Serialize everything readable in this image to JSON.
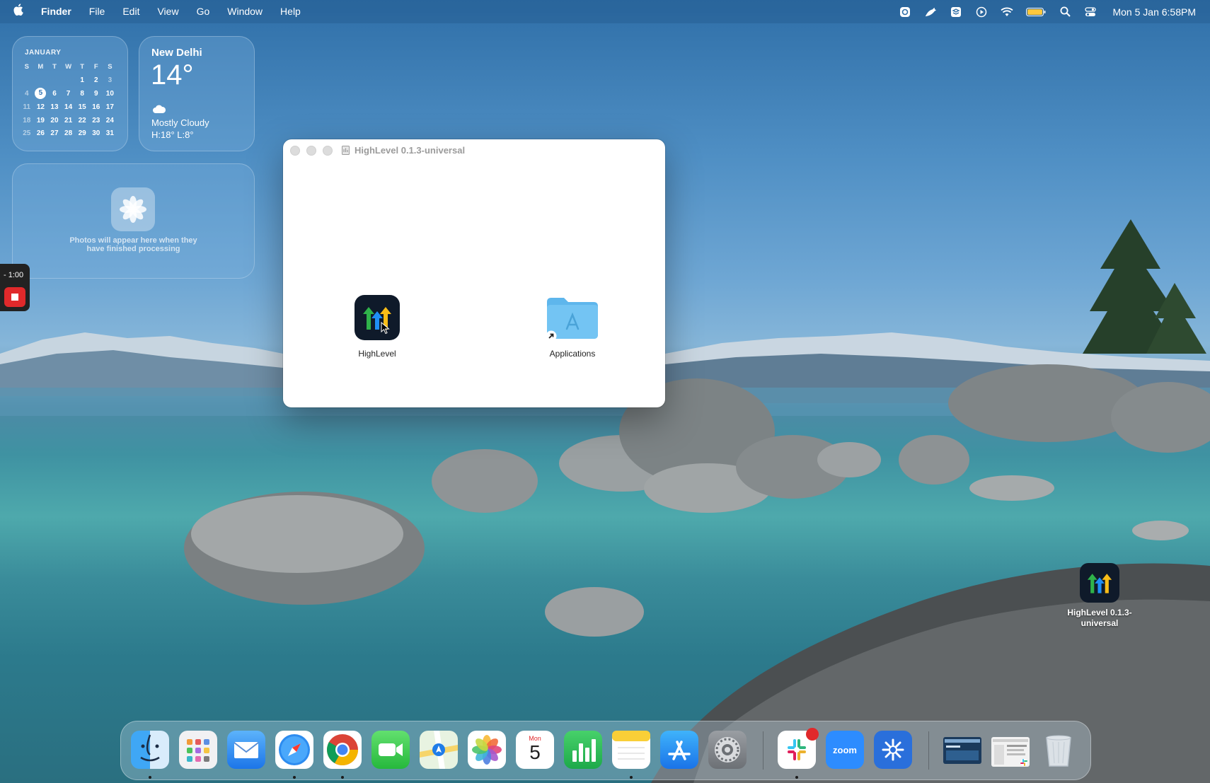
{
  "menubar": {
    "apple": "",
    "app_name": "Finder",
    "menus": [
      "File",
      "Edit",
      "View",
      "Go",
      "Window",
      "Help"
    ],
    "clock": "Mon 5 Jan  6:58PM"
  },
  "calendar": {
    "month": "JANUARY",
    "weekdays": [
      "S",
      "M",
      "T",
      "W",
      "T",
      "F",
      "S"
    ],
    "weeks": [
      [
        "",
        "",
        "",
        "",
        "1",
        "2",
        "3"
      ],
      [
        "4",
        "5",
        "6",
        "7",
        "8",
        "9",
        "10"
      ],
      [
        "11",
        "12",
        "13",
        "14",
        "15",
        "16",
        "17"
      ],
      [
        "18",
        "19",
        "20",
        "21",
        "22",
        "23",
        "24"
      ],
      [
        "25",
        "26",
        "27",
        "28",
        "29",
        "30",
        "31"
      ]
    ],
    "today": "5"
  },
  "weather": {
    "city": "New Delhi",
    "temp": "14°",
    "condition": "Mostly Cloudy",
    "high_low": "H:18° L:8°"
  },
  "photos_widget": {
    "message": "Photos will appear here when they have finished processing"
  },
  "recorder": {
    "time": "- 1:00"
  },
  "window": {
    "title": "HighLevel 0.1.3-universal",
    "items": [
      {
        "label": "HighLevel"
      },
      {
        "label": "Applications"
      }
    ]
  },
  "desktop": {
    "icon_label": "HighLevel 0.1.3-universal"
  },
  "dock": {
    "apps": [
      "Finder",
      "Launchpad",
      "Mail",
      "Safari",
      "Chrome",
      "FaceTime",
      "Maps",
      "Photos",
      "Calendar",
      "Numbers",
      "Notes",
      "App Store",
      "System Settings",
      "Slack",
      "Zoom",
      "Perplexity"
    ],
    "calendar_day": "Mon",
    "calendar_date": "5",
    "zoom_label": "zoom"
  },
  "colors": {
    "accent_blue": "#2f73b4",
    "record_red": "#e0292b"
  }
}
